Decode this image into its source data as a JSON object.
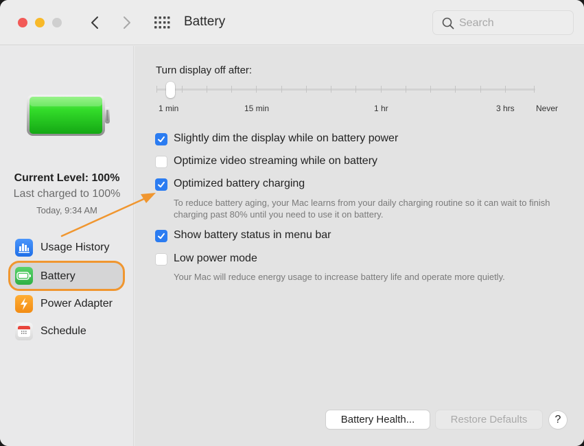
{
  "window": {
    "title": "Battery",
    "traffic_lights": [
      "close",
      "minimize",
      "zoom"
    ],
    "nav": {
      "back_icon": "chevron-left-icon",
      "forward_icon": "chevron-right-icon",
      "grid_icon": "show-all-grid-icon"
    }
  },
  "search": {
    "placeholder": "Search",
    "value": "",
    "icon": "magnifier-icon"
  },
  "sidebar": {
    "battery_status": {
      "level_percent": 100,
      "current_level": "Current Level: 100%",
      "last_charged": "Last charged to 100%",
      "charged_time": "Today, 9:34 AM"
    },
    "items": [
      {
        "label": "Usage History",
        "icon": "bar-chart-icon",
        "color": "#2f7cf6",
        "selected": false
      },
      {
        "label": "Battery",
        "icon": "battery-icon",
        "color": "#3dbf4f",
        "selected": true
      },
      {
        "label": "Power Adapter",
        "icon": "lightning-bolt-icon",
        "color": "#f59a1f",
        "selected": false
      },
      {
        "label": "Schedule",
        "icon": "calendar-icon",
        "color": "#e8453c",
        "selected": false
      }
    ]
  },
  "main": {
    "display_off": {
      "label": "Turn display off after:",
      "selected_value": "1 min",
      "tick_count": 16,
      "tick_labels": [
        "1 min",
        "15 min",
        "1 hr",
        "3 hrs",
        "Never"
      ]
    },
    "options": [
      {
        "label": "Slightly dim the display while on battery power",
        "checked": true
      },
      {
        "label": "Optimize video streaming while on battery",
        "checked": false
      },
      {
        "label": "Optimized battery charging",
        "checked": true,
        "description": "To reduce battery aging, your Mac learns from your daily charging routine so it can wait to finish charging past 80% until you need to use it on battery."
      },
      {
        "label": "Show battery status in menu bar",
        "checked": true
      },
      {
        "label": "Low power mode",
        "checked": false,
        "description": "Your Mac will reduce energy usage to increase battery life and operate more quietly."
      }
    ],
    "buttons": {
      "battery_health": "Battery Health...",
      "restore_defaults": "Restore Defaults",
      "restore_defaults_enabled": false,
      "help": "?"
    }
  },
  "annotation": {
    "color": "#f0962f",
    "description": "Orange arrow pointing to Optimized battery charging; orange outline on Battery sidebar item"
  }
}
